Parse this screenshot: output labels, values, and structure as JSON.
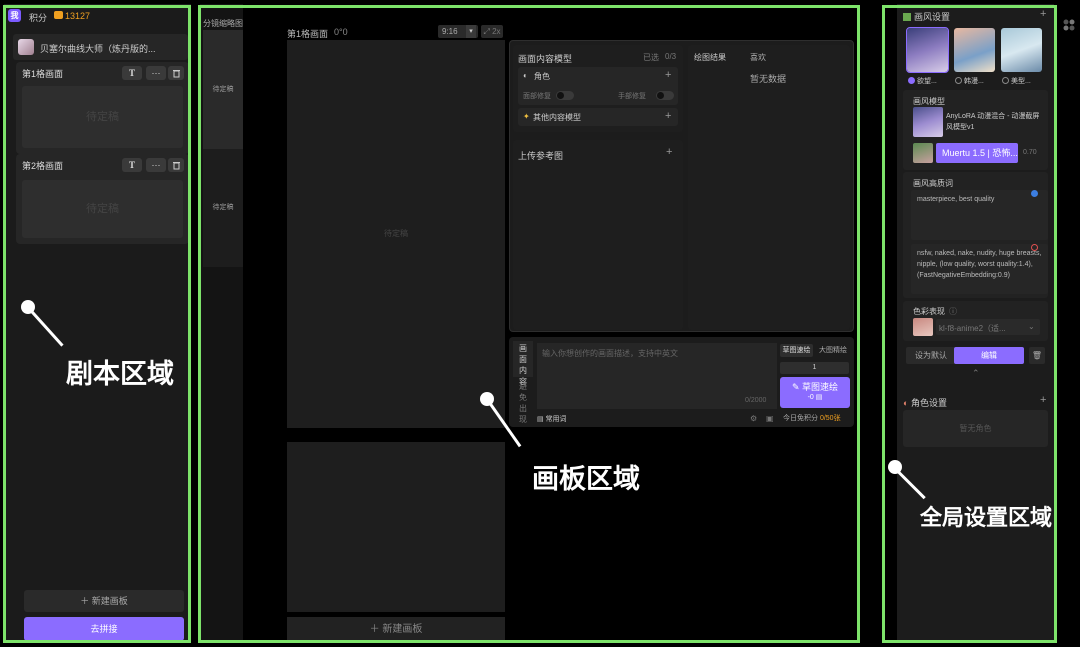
{
  "left_panel": {
    "logo_text": "我",
    "points_label": "积分",
    "points_value": "13127",
    "script_title": "贝塞尔曲线大师（炼丹版的...",
    "panels": [
      {
        "title": "第1格画面",
        "pending": "待定稿"
      },
      {
        "title": "第2格画面",
        "pending": "待定稿"
      }
    ],
    "text_btn": "T",
    "more_btn": "···",
    "new_panel": "＋  新建画板",
    "go_btn": "去拼接"
  },
  "thumbs": {
    "title": "分镜缩略图",
    "items": [
      "待定稿",
      "待定稿"
    ]
  },
  "canvas": {
    "title": "第1格画面",
    "coord": "0°0",
    "ratio": "9:16",
    "zoom": "2x",
    "pending": "待定稿",
    "new_canvas": "＋  新建画板"
  },
  "content_model": {
    "title": "画面内容模型",
    "selected": "已选",
    "count": "0/3",
    "role": "角色",
    "face_fix": "面部修复",
    "hand_fix": "手部修复",
    "other_models": "其他内容模型"
  },
  "results": {
    "title": "绘图结果",
    "fav": "喜欢",
    "empty": "暂无数据"
  },
  "upload": {
    "title": "上传参考图"
  },
  "prompt": {
    "tab1": "画面内容",
    "tab2": "避免出现",
    "placeholder": "输入你想创作的画面描述，支持中英文",
    "counter": "0/2000",
    "common_words": "常用词",
    "sketch_mode": "草图速绘",
    "hd_mode": "大图精绘",
    "qty": "1",
    "draw_btn": "草图速绘",
    "draw_cost": "-0",
    "quota_label": "今日免积分",
    "quota_value": "0/50张"
  },
  "global": {
    "style_title": "画风设置",
    "styles": [
      "欲望...",
      "韩漫...",
      "美型..."
    ],
    "model_title": "画风模型",
    "model_name": "AnyLoRA 动漫混合 - 动漫截屏风模型v1",
    "lora_name": "Muertu 1.5 | 恐怖...",
    "lora_weight": "0.70",
    "prompt_title": "画风高质词",
    "positive": "masterpiece, best quality",
    "negative": "nsfw, naked, nake, nudity, huge breasts, nipple, (low quality, worst quality:1.4), (FastNegativeEmbedding:0.9)",
    "color_title": "色彩表现",
    "color_value": "kl-f8-anime2（适...",
    "set_default": "设为默认",
    "edit": "编辑",
    "role_title": "角色设置",
    "role_empty": "暂无角色"
  },
  "annotations": {
    "script_area": "剧本区域",
    "canvas_area": "画板区域",
    "global_area": "全局设置区域"
  }
}
